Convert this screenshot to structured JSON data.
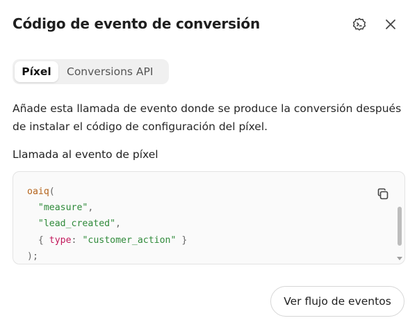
{
  "dialog": {
    "title": "Código de evento de conversión",
    "debug_icon": "debug-icon",
    "close_icon": "close-icon"
  },
  "tabs": [
    {
      "label": "Píxel",
      "active": true
    },
    {
      "label": "Conversions API",
      "active": false
    }
  ],
  "description": "Añade esta llamada de evento donde se produce la conversión después de instalar el código de configuración del píxel.",
  "code_section": {
    "label": "Llamada al evento de píxel",
    "copy_icon": "copy-icon",
    "lines": {
      "fn": "oaiq",
      "open": "(",
      "arg1": "\"measure\"",
      "arg2": "\"lead_created\"",
      "key": "type",
      "value": "\"customer_action\"",
      "close": ");"
    }
  },
  "footer": {
    "view_events_label": "Ver flujo de eventos"
  },
  "colors": {
    "function": "#b5651d",
    "string": "#2f8a3a",
    "key": "#c2185b"
  }
}
